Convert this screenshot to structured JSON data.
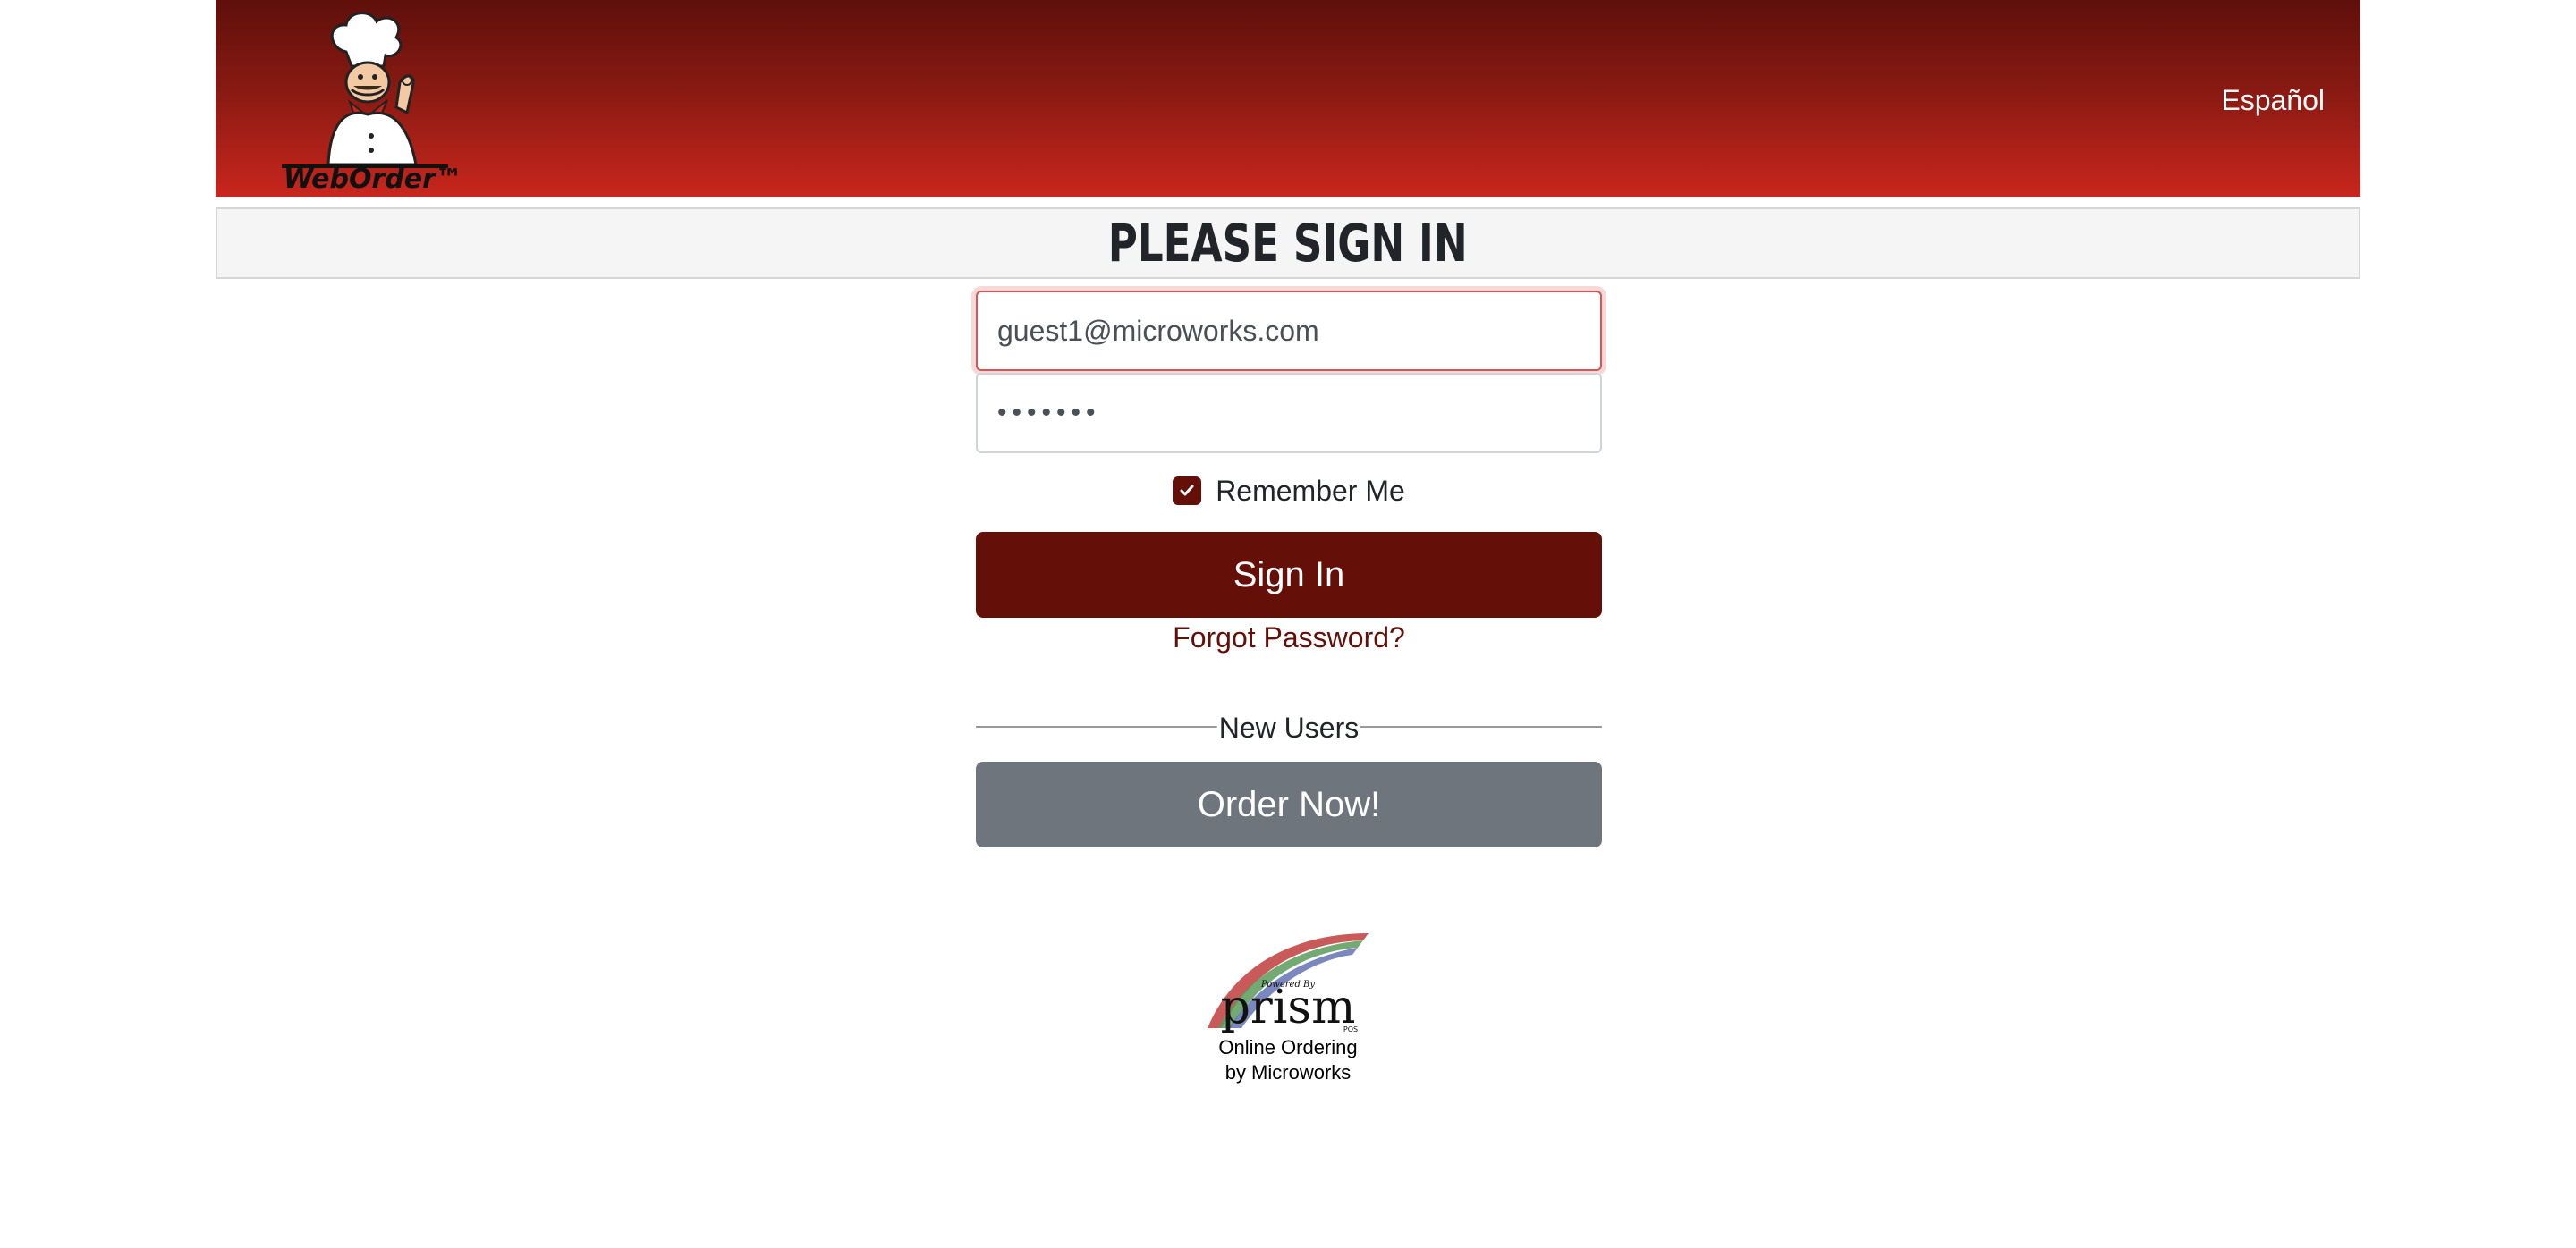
{
  "header": {
    "logo_text": "WebOrder™",
    "language_link": "Español"
  },
  "page_title": "Please Sign In",
  "form": {
    "email_value": "guest1@microworks.com",
    "password_mask": "•••••••",
    "remember_label": "Remember Me",
    "remember_checked": true,
    "signin_label": "Sign In",
    "forgot_label": "Forgot Password?",
    "new_users_label": "New Users",
    "order_label": "Order Now!"
  },
  "footer": {
    "logo_small": "Powered By",
    "logo_word": "prism",
    "logo_sub": "POS",
    "line1": "Online Ordering",
    "line2": "by Microworks"
  },
  "colors": {
    "header_dark": "#5f0f0b",
    "header_light": "#c8261d",
    "primary": "#641009",
    "secondary": "#6e757d",
    "invalid_border": "#dc5353"
  }
}
